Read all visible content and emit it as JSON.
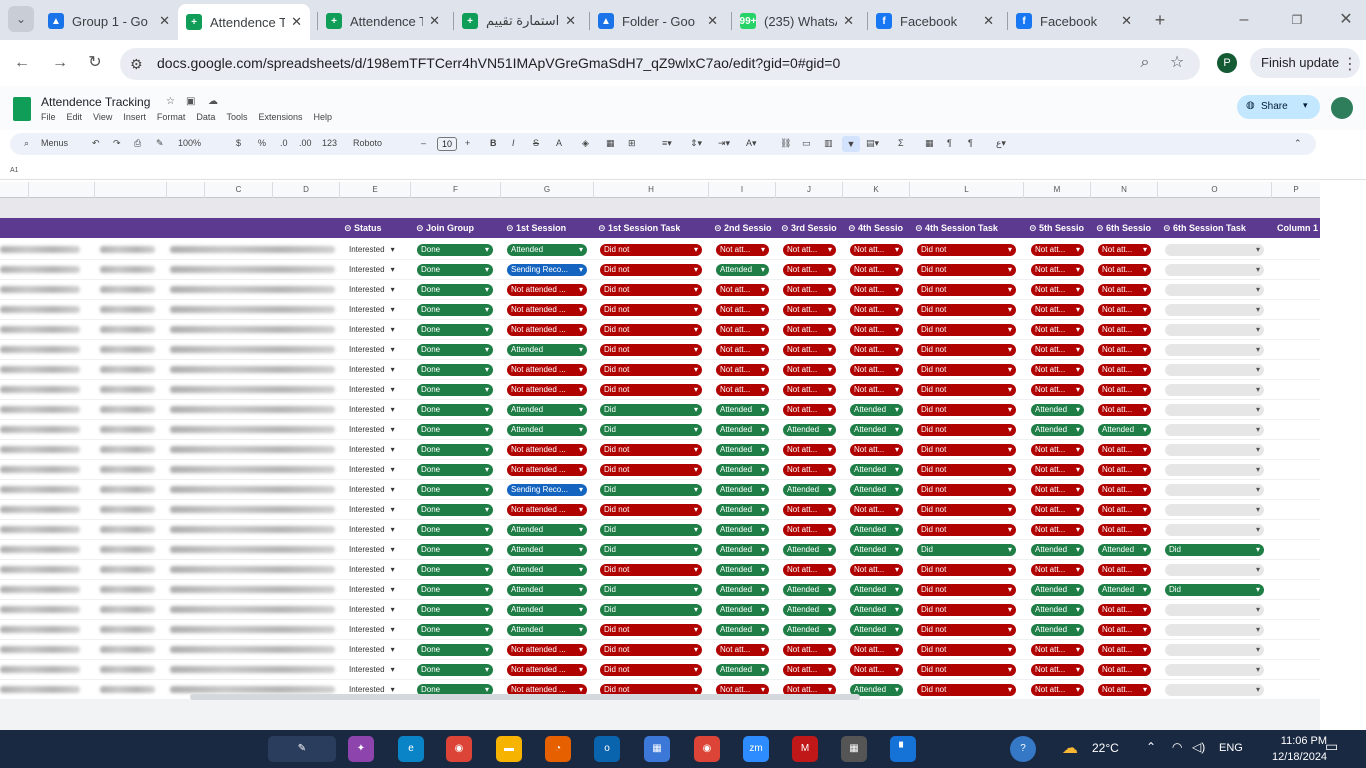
{
  "tabs": [
    {
      "title": "Group 1 - Go",
      "color": "#1a73e8",
      "glyph": "▲"
    },
    {
      "title": "Attendence T",
      "color": "#0f9d58",
      "glyph": "+"
    },
    {
      "title": "Attendence T",
      "color": "#0f9d58",
      "glyph": "+"
    },
    {
      "title": "استمارة تقييم",
      "color": "#0f9d58",
      "glyph": "+"
    },
    {
      "title": "Folder - Goo",
      "color": "#1a73e8",
      "glyph": "▲"
    },
    {
      "title": "(235) WhatsA",
      "color": "#25d366",
      "glyph": "99+"
    },
    {
      "title": "Facebook",
      "color": "#1877f2",
      "glyph": "f"
    },
    {
      "title": "Facebook",
      "color": "#1877f2",
      "glyph": "f"
    }
  ],
  "browser": {
    "url": "docs.google.com/spreadsheets/d/198emTFTCerr4hVN51IMApVGreGmaSdH7_qZ9wlxC7ao/edit?gid=0#gid=0",
    "finish_update": "Finish update",
    "profile": "P"
  },
  "doc": {
    "title": "Attendence Tracking",
    "share": "Share",
    "menus": [
      "File",
      "Edit",
      "View",
      "Insert",
      "Format",
      "Data",
      "Tools",
      "Extensions",
      "Help"
    ]
  },
  "toolbar": {
    "search": "Menus",
    "zoom": "100%",
    "currency": "$",
    "percent": "%",
    "dec_dec": ".0",
    "dec_inc": ".00",
    "num": "123",
    "font": "Roboto",
    "size": "10",
    "bold": "B",
    "italic": "I",
    "strike": "S",
    "textcolor": "A",
    "sigma": "Σ"
  },
  "cell_ref": "A1",
  "columns": [
    "C",
    "D",
    "E",
    "F",
    "G",
    "H",
    "I",
    "J",
    "K",
    "L",
    "M",
    "N",
    "O",
    "P"
  ],
  "headers": [
    "Status",
    "Join Group",
    "1st Session",
    "1st Session Task",
    "2nd Sessio",
    "3rd Sessio",
    "4th Sessio",
    "4th Session Task",
    "5th Sessio",
    "6th Sessio",
    "6th Session Task",
    "Column 1"
  ],
  "labels": {
    "G": "Attended",
    "R1": "Did not",
    "R2": "Not att...",
    "R3": "Not attended ...",
    "D": "Did",
    "S": "Sending Reco...",
    "A": "Attended",
    "I": "Interested",
    "Done": "Done"
  },
  "rows": [
    "GRRRRRRRR-",
    "BRGRRRRRR-",
    "RRRRRRRRR-",
    "RRRRRRRRR-",
    "RRRRRRRRR-",
    "GRRRRRRRR-",
    "RRRRRRRRR-",
    "RRRRRRRRR-",
    "GDGRGRGR-X",
    "GDGGGRGG-X",
    "RRGRRRRR-X",
    "RRGRGRRR-X",
    "BDGGGRRR-X",
    "RRGRRRRR-X",
    "GDGRGRRR-X",
    "GDGGGDGGD",
    "GRGRRRRR-X",
    "GDGGGRGGD",
    "GDGGGRGR-X",
    "GRGGGRGR-X",
    "RRRRRRRR-X",
    "RRGRRRRR-X",
    "RRRRGRRR-X"
  ],
  "taskbar": {
    "temp": "22°C",
    "lang": "ENG",
    "time": "11:06 PM",
    "date": "12/18/2024"
  }
}
